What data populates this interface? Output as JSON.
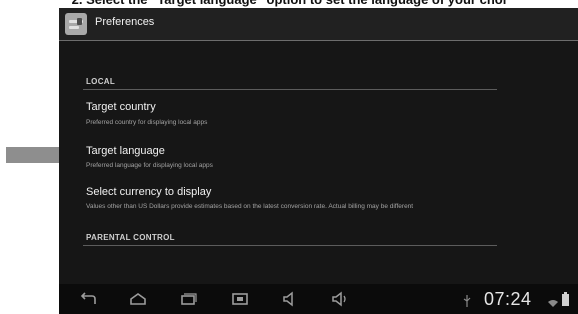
{
  "instruction": {
    "text": "2. Select the \"Target language\" option to set the language of your choi"
  },
  "action_bar": {
    "title": "Preferences",
    "icon": "preferences-app-icon"
  },
  "sections": {
    "local_header": "LOCAL",
    "parental_header": "PARENTAL CONTROL"
  },
  "preferences": [
    {
      "title": "Target country",
      "summary": "Preferred country for displaying local apps"
    },
    {
      "title": "Target language",
      "summary": "Preferred language for displaying local apps"
    },
    {
      "title": "Select currency to display",
      "summary": "Values other than US Dollars provide estimates based on the latest conversion rate. Actual billing may be different"
    }
  ],
  "nav_bar": {
    "icons": [
      "back-icon",
      "home-icon",
      "recent-apps-icon",
      "screenshot-icon",
      "volume-down-icon",
      "volume-up-icon"
    ]
  },
  "status_bar": {
    "time": "07:24",
    "icons": [
      "usb-icon",
      "wifi-icon",
      "battery-icon"
    ]
  },
  "colors": {
    "screen_background": "#161616",
    "arrow": "#8e8e8e",
    "text_primary": "#f1f1f1",
    "text_secondary": "#a3a3a3"
  }
}
